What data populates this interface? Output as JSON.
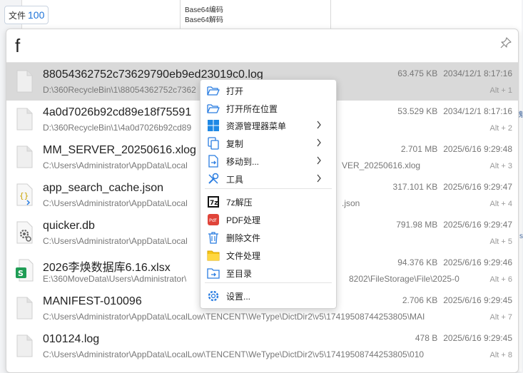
{
  "background": {
    "menu_items": [
      "Base64编码",
      "Base64解码"
    ],
    "right_texts": [
      "魏",
      "s"
    ]
  },
  "badge": {
    "label": "文件",
    "count": "100"
  },
  "search": {
    "query": "f"
  },
  "results": [
    {
      "name": "88054362752c73629790eb9ed23019c0.log",
      "path": "D:\\360RecycleBin\\1\\88054362752c7362",
      "size": "63.475 KB",
      "date": "2034/12/1 8:17:16",
      "hotkey": "Alt + 1",
      "icon": "doc-icon",
      "selected": true
    },
    {
      "name": "4a0d7026b92cd89e18f75591",
      "path": "D:\\360RecycleBin\\1\\4a0d7026b92cd89",
      "size": "53.529 KB",
      "date": "2034/12/1 8:17:16",
      "hotkey": "Alt + 2",
      "icon": "doc-icon"
    },
    {
      "name": "MM_SERVER_20250616.xlog",
      "path": "C:\\Users\\Administrator\\AppData\\Local",
      "path_tail": "VER_20250616.xlog",
      "size": "2.701 MB",
      "date": "2025/6/16 9:29:48",
      "hotkey": "Alt + 3",
      "icon": "doc-icon"
    },
    {
      "name": "app_search_cache.json",
      "path": "C:\\Users\\Administrator\\AppData\\Local",
      "path_tail": ".json",
      "size": "317.101 KB",
      "date": "2025/6/16 9:29:47",
      "hotkey": "Alt + 4",
      "icon": "json-icon"
    },
    {
      "name": "quicker.db",
      "path": "C:\\Users\\Administrator\\AppData\\Local",
      "size": "791.98 MB",
      "date": "2025/6/16 9:29:47",
      "hotkey": "Alt + 5",
      "icon": "db-gear-icon"
    },
    {
      "name": "2026李焕数据库6.16.xlsx",
      "path": "E:\\360MoveData\\Users\\Administrator\\",
      "path_tail": "8202\\FileStorage\\File\\2025-0",
      "size": "94.376 KB",
      "date": "2025/6/16 9:29:46",
      "hotkey": "Alt + 6",
      "icon": "spreadsheet-icon"
    },
    {
      "name": "MANIFEST-010096",
      "path": "C:\\Users\\Administrator\\AppData\\LocalLow\\TENCENT\\WeType\\DictDir2\\v5\\17419508744253805\\MAI",
      "size": "2.706 KB",
      "date": "2025/6/16 9:29:45",
      "hotkey": "Alt + 7",
      "icon": "doc-icon"
    },
    {
      "name": "010124.log",
      "path": "C:\\Users\\Administrator\\AppData\\LocalLow\\TENCENT\\WeType\\DictDir2\\v5\\17419508744253805\\010",
      "size": "478 B",
      "date": "2025/6/16 9:29:45",
      "hotkey": "Alt + 8",
      "icon": "doc-icon"
    }
  ],
  "context_menu": {
    "items": [
      {
        "label": "打开",
        "icon": "folder-open-icon",
        "submenu": false
      },
      {
        "label": "打开所在位置",
        "icon": "folder-location-icon",
        "submenu": false
      },
      {
        "label": "资源管理器菜单",
        "icon": "windows-icon",
        "submenu": true
      },
      {
        "label": "复制",
        "icon": "copy-icon",
        "submenu": true
      },
      {
        "label": "移动到...",
        "icon": "move-icon",
        "submenu": true
      },
      {
        "label": "工具",
        "icon": "tools-icon",
        "submenu": true
      },
      {
        "label": "7z解压",
        "icon": "7z-icon",
        "submenu": false
      },
      {
        "label": "PDF处理",
        "icon": "pdf-icon",
        "submenu": false
      },
      {
        "label": "删除文件",
        "icon": "trash-icon",
        "submenu": false
      },
      {
        "label": "文件处理",
        "icon": "folder-yellow-icon",
        "submenu": false
      },
      {
        "label": "至目录",
        "icon": "goto-folder-icon",
        "submenu": false
      },
      {
        "label": "设置...",
        "icon": "gear-icon",
        "submenu": false
      }
    ]
  },
  "colors": {
    "accent": "#1e73d8",
    "selected_row": "#d9d9d9",
    "pdf_red": "#e0443a",
    "excel_green": "#1f9d55"
  }
}
